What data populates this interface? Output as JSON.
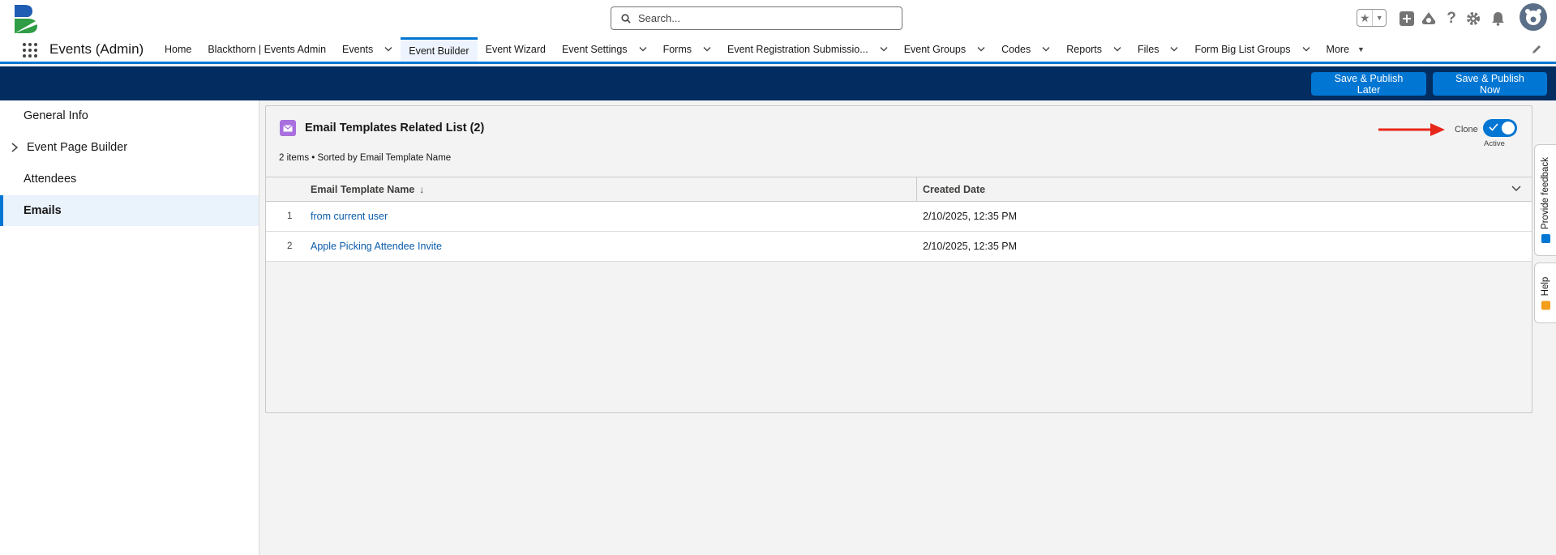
{
  "header": {
    "search_placeholder": "Search...",
    "icons": [
      "favorites-star-icon",
      "add-icon",
      "trailhead-icon",
      "help-icon",
      "setup-gear-icon",
      "notification-bell-icon",
      "user-avatar"
    ]
  },
  "nav": {
    "app_name": "Events (Admin)",
    "tabs": [
      {
        "label": "Home",
        "dropdown": false,
        "active": false
      },
      {
        "label": "Blackthorn | Events Admin",
        "dropdown": false,
        "active": false
      },
      {
        "label": "Events",
        "dropdown": true,
        "active": false
      },
      {
        "label": "Event Builder",
        "dropdown": false,
        "active": true
      },
      {
        "label": "Event Wizard",
        "dropdown": false,
        "active": false
      },
      {
        "label": "Event Settings",
        "dropdown": true,
        "active": false
      },
      {
        "label": "Forms",
        "dropdown": true,
        "active": false
      },
      {
        "label": "Event Registration Submissio...",
        "dropdown": true,
        "active": false
      },
      {
        "label": "Event Groups",
        "dropdown": true,
        "active": false
      },
      {
        "label": "Codes",
        "dropdown": true,
        "active": false
      },
      {
        "label": "Reports",
        "dropdown": true,
        "active": false
      },
      {
        "label": "Files",
        "dropdown": true,
        "active": false
      },
      {
        "label": "Form Big List Groups",
        "dropdown": true,
        "active": false
      }
    ],
    "more_label": "More"
  },
  "actions": {
    "save_later": "Save & Publish Later",
    "save_now": "Save & Publish Now"
  },
  "sidebar": {
    "items": [
      {
        "label": "General Info"
      },
      {
        "label": "Event Page Builder"
      },
      {
        "label": "Attendees"
      },
      {
        "label": "Emails"
      }
    ]
  },
  "card": {
    "title": "Email Templates Related List (2)",
    "meta": "2 items • Sorted by Email Template Name",
    "clone_label": "Clone",
    "toggle_status": "Active",
    "columns": {
      "name": "Email Template Name",
      "sort_indicator": "↓",
      "date": "Created Date"
    },
    "rows": [
      {
        "num": "1",
        "name": "from current user",
        "date": "2/10/2025, 12:35 PM"
      },
      {
        "num": "2",
        "name": "Apple Picking Attendee Invite",
        "date": "2/10/2025, 12:35 PM"
      }
    ]
  },
  "utility": {
    "feedback": "Provide feedback",
    "help": "Help"
  },
  "colors": {
    "brand_blue": "#0176d3",
    "band": "#032d60",
    "link": "#0b5cab",
    "email_icon": "#a86fde",
    "annotation_arrow": "#e8271b"
  }
}
